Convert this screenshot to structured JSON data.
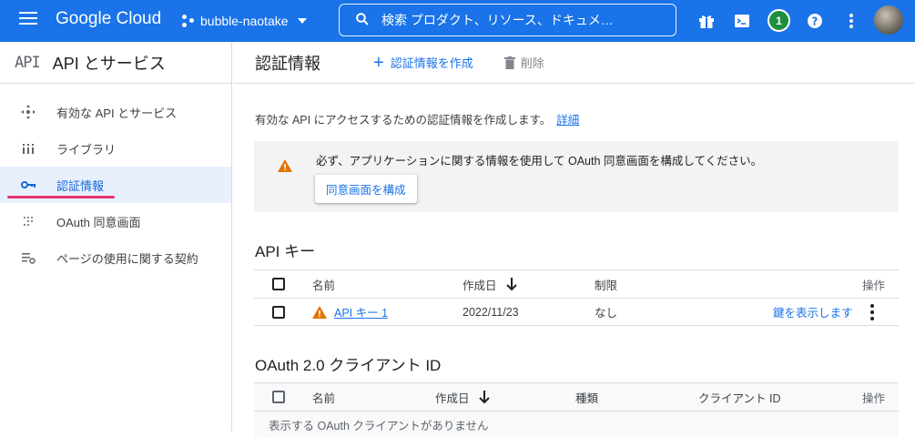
{
  "topbar": {
    "logo": "Google Cloud",
    "project": "bubble-naotake",
    "search_placeholder": "検索  プロダクト、リソース、ドキュメ…",
    "notification_count": "1"
  },
  "sidebar": {
    "logo_text": "API",
    "title": "API とサービス",
    "items": [
      {
        "label": "有効な API とサービス",
        "icon": "enabled-apis-icon"
      },
      {
        "label": "ライブラリ",
        "icon": "library-icon"
      },
      {
        "label": "認証情報",
        "icon": "key-icon"
      },
      {
        "label": "OAuth 同意画面",
        "icon": "oauth-icon"
      },
      {
        "label": "ページの使用に関する契約",
        "icon": "agreements-icon"
      }
    ]
  },
  "main": {
    "title": "認証情報",
    "create_label": "認証情報を作成",
    "delete_label": "削除",
    "description": "有効な API にアクセスするための認証情報を作成します。",
    "learn_more": "詳細",
    "warning": {
      "text": "必ず、アプリケーションに関する情報を使用して OAuth 同意画面を構成してください。",
      "button": "同意画面を構成"
    },
    "api_keys": {
      "title": "API キー",
      "headers": {
        "name": "名前",
        "created": "作成日",
        "restriction": "制限",
        "actions": "操作"
      },
      "rows": [
        {
          "name": "API キー 1",
          "created": "2022/11/23",
          "restriction": "なし",
          "action": "鍵を表示します"
        }
      ]
    },
    "oauth": {
      "title": "OAuth 2.0 クライアント ID",
      "headers": {
        "name": "名前",
        "created": "作成日",
        "type": "種類",
        "client_id": "クライアント ID",
        "actions": "操作"
      },
      "empty": "表示する OAuth クライアントがありません"
    }
  },
  "colors": {
    "brand": "#1a73e8",
    "active_indicator": "#e8336c",
    "warning": "#e37400"
  }
}
